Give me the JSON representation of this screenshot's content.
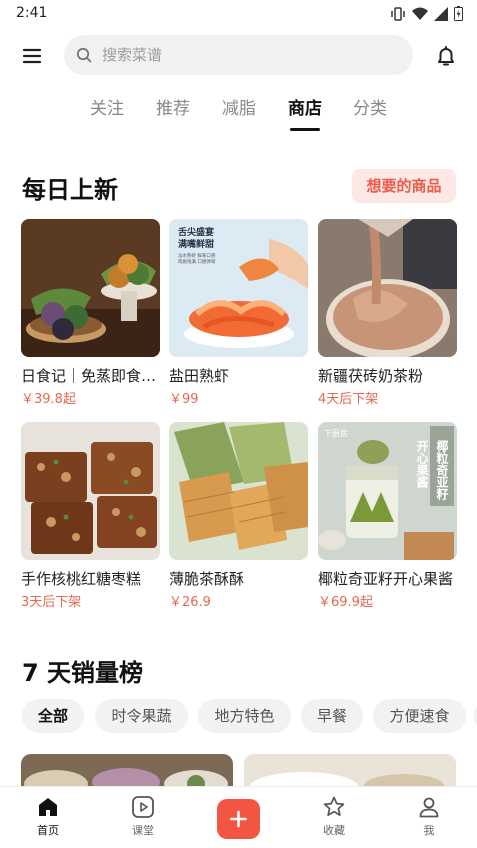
{
  "status_bar": {
    "time": "2:41",
    "icons": [
      "vibrate-icon",
      "wifi-icon",
      "signal-icon",
      "battery-charging-icon"
    ]
  },
  "search": {
    "placeholder": "搜索菜谱",
    "value": ""
  },
  "tabs": [
    {
      "label": "关注",
      "active": false
    },
    {
      "label": "推荐",
      "active": false
    },
    {
      "label": "减脂",
      "active": false
    },
    {
      "label": "商店",
      "active": true
    },
    {
      "label": "分类",
      "active": false
    }
  ],
  "daily_new": {
    "title": "每日上新",
    "want_button": "想要的商品",
    "products": [
      {
        "name": "日食记｜免蒸即食青团",
        "price": "￥39.8起"
      },
      {
        "name": "盐田熟虾",
        "price": "￥99"
      },
      {
        "name": "新疆茯砖奶茶粉",
        "price": "4天后下架"
      },
      {
        "name": "手作核桃红糖枣糕",
        "price": "3天后下架"
      },
      {
        "name": "薄脆茶酥酥",
        "price": "￥26.9"
      },
      {
        "name": "椰粒奇亚籽开心果酱",
        "price": "￥69.9起"
      }
    ],
    "image_text": {
      "shrimp_line1": "舌尖盛宴",
      "shrimp_line2": "满嘴鲜甜",
      "shrimp_line3": "淡水熟虾 鲜味口感",
      "shrimp_line4": "肉质饱满 口感弹韧",
      "jam_brand": "下厨房",
      "jam_col1": "椰粒奇亚籽",
      "jam_col2": "开心果酱"
    }
  },
  "weekly_rank": {
    "title": "7 天销量榜",
    "chips": [
      {
        "label": "全部",
        "active": true
      },
      {
        "label": "时令果蔬",
        "active": false
      },
      {
        "label": "地方特色",
        "active": false
      },
      {
        "label": "早餐",
        "active": false
      },
      {
        "label": "方便速食",
        "active": false
      }
    ]
  },
  "bottom_nav": [
    {
      "label": "首页",
      "icon": "home-icon",
      "active": true
    },
    {
      "label": "课堂",
      "icon": "play-icon",
      "active": false
    },
    {
      "label": "",
      "icon": "plus-icon",
      "active": false
    },
    {
      "label": "收藏",
      "icon": "star-icon",
      "active": false
    },
    {
      "label": "我",
      "icon": "user-icon",
      "active": false
    }
  ],
  "colors": {
    "accent": "#f25541",
    "price": "#e8674f",
    "want_bg": "#fde8e5",
    "chip_bg": "#f2f2f2"
  }
}
